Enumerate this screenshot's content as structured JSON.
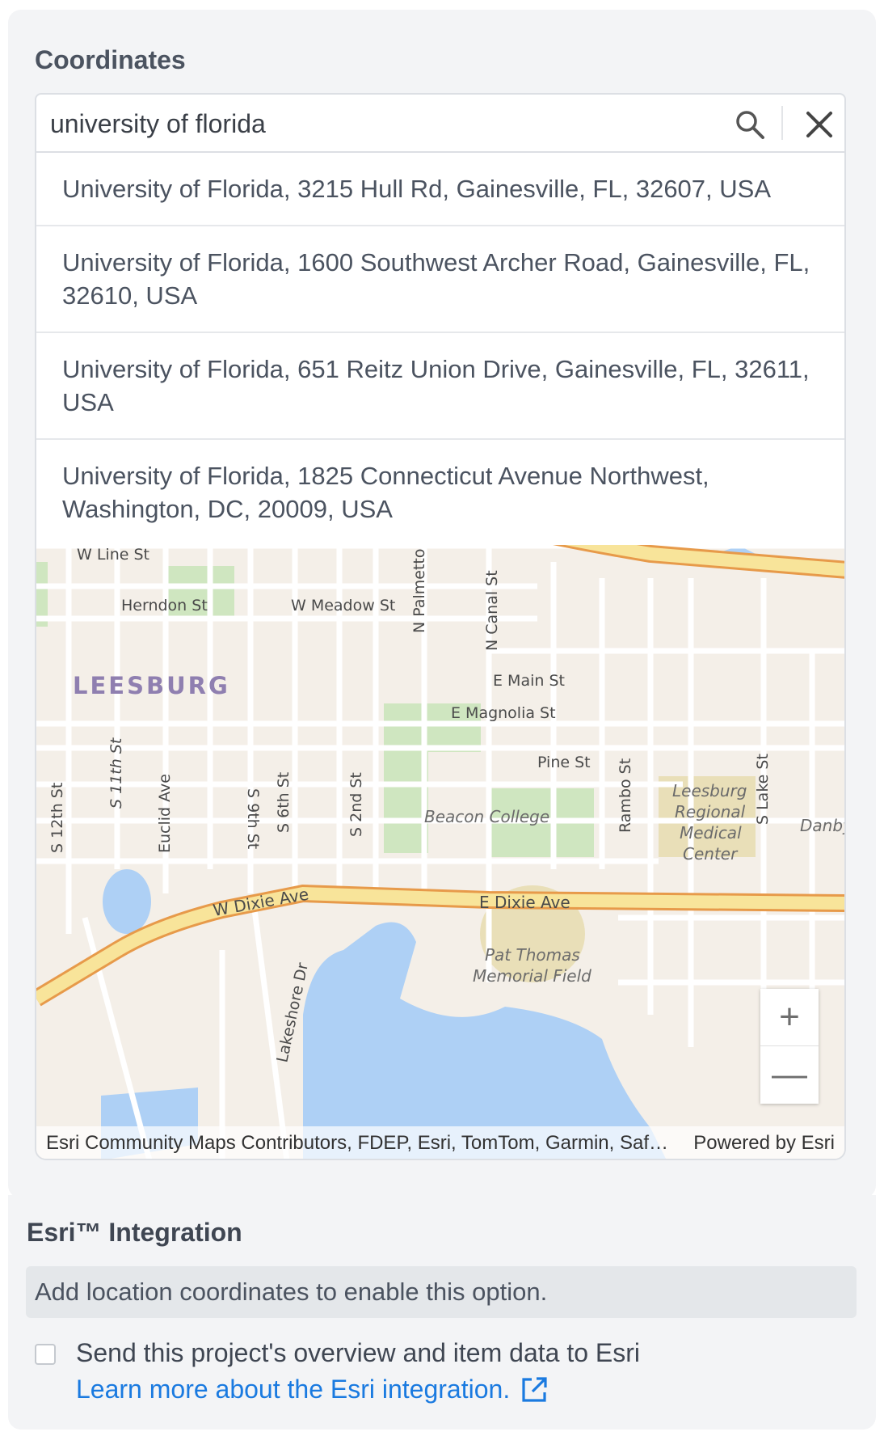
{
  "coordinates": {
    "title": "Coordinates",
    "search": {
      "value": "university of florida",
      "search_icon": "search-icon",
      "clear_icon": "close-icon"
    },
    "suggestions": [
      "University of Florida, 3215 Hull Rd, Gainesville, FL, 32607, USA",
      "University of Florida, 1600 Southwest Archer Road, Gainesville, FL, 32610, USA",
      "University of Florida, 651 Reitz Union Drive, Gainesville, FL, 32611, USA",
      "University of Florida, 1825 Connecticut Avenue Northwest, Washington, DC, 20009, USA"
    ]
  },
  "map": {
    "labels": {
      "w_line_st": "W Line St",
      "herndon_st": "Herndon St",
      "w_meadow_st": "W Meadow St",
      "n_palmetto": "N Palmetto",
      "n_canal_st": "N Canal St",
      "leesburg": "LEESBURG",
      "e_main_st": "E Main St",
      "e_magnolia_st": "E Magnolia St",
      "s_11th_st": "S 11th St",
      "s_12th_st": "S 12th St",
      "euclid_ave": "Euclid Ave",
      "s_9th_st": "S 9th St",
      "s_6th_st": "S 6th St",
      "s_2nd_st": "S 2nd St",
      "pine_st": "Pine St",
      "rambo_st": "Rambo St",
      "s_lake_st": "S Lake St",
      "beacon_college": "Beacon College",
      "hospital_1": "Leesburg",
      "hospital_2": "Regional",
      "hospital_3": "Medical",
      "hospital_4": "Center",
      "danby": "Danby",
      "w_dixie_ave": "W Dixie Ave",
      "e_dixie_ave": "E Dixie Ave",
      "pat_thomas_1": "Pat Thomas",
      "pat_thomas_2": "Memorial Field",
      "lakeshore_dr": "Lakeshore Dr"
    },
    "zoom_in": "+",
    "zoom_out": "—",
    "attribution": "Esri Community Maps Contributors, FDEP, Esri, TomTom, Garmin, SafeGraph, GeoTechnologies, Inc, METI/NASA, USGS, EPA, NPS, US Census Bureau, USDA, USFWS",
    "powered_by": "Powered by Esri",
    "colors": {
      "land": "#f4efe8",
      "water": "#aed0f5",
      "park": "#cfe6c0",
      "highway": "#f8e49a",
      "highway_border": "#e79a4a",
      "road": "#ffffff"
    }
  },
  "esri": {
    "title": "Esri™ Integration",
    "notice": "Add location coordinates to enable this option.",
    "checkbox_label": "Send this project's overview and item data to Esri",
    "learn_more": "Learn more about the Esri integration.",
    "external_icon": "external-link-icon"
  }
}
